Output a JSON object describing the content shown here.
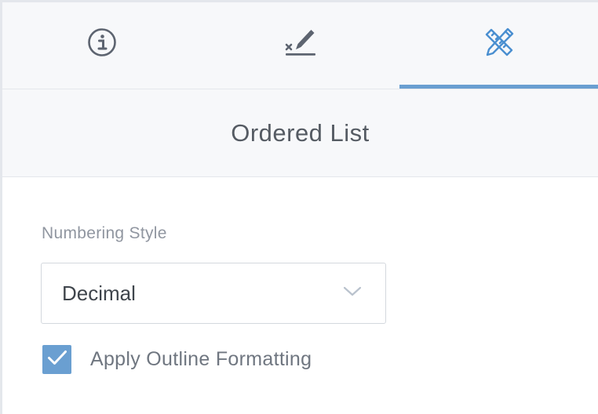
{
  "tabs": [
    {
      "icon": "info-icon",
      "active": false
    },
    {
      "icon": "signature-icon",
      "active": false
    },
    {
      "icon": "ruler-pencil-icon",
      "active": true
    }
  ],
  "colors": {
    "accent": "#6a9fd1",
    "panel_bg": "#f7f8fa",
    "border": "#e4e7ec",
    "icon_gray": "#5d6470"
  },
  "section": {
    "title": "Ordered List"
  },
  "numbering": {
    "label": "Numbering Style",
    "value": "Decimal"
  },
  "outline": {
    "label": "Apply Outline Formatting",
    "checked": true
  }
}
